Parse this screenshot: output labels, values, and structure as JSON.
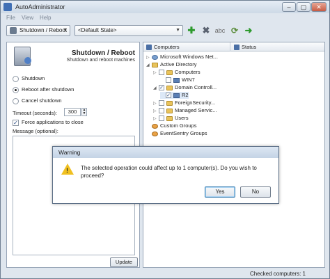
{
  "window": {
    "title": "AutoAdministrator"
  },
  "menu": [
    "File",
    "View",
    "Help"
  ],
  "toolbar": {
    "action_combo": "Shutdown / Reboot",
    "state_combo": "<Default State>",
    "icons": [
      "add-icon",
      "delete-icon",
      "rename-icon",
      "refresh-icon",
      "run-icon"
    ],
    "abc_label": "abc"
  },
  "left": {
    "title": "Shutdown / Reboot",
    "subtitle": "Shutdown and reboot machines",
    "options": [
      {
        "label": "Shutdown",
        "selected": false
      },
      {
        "label": "Reboot after shutdown",
        "selected": true
      },
      {
        "label": "Cancel shutdown",
        "selected": false
      }
    ],
    "timeout_label": "Timeout (seconds):",
    "timeout_value": "300",
    "force_label": "Force applications to close",
    "force_checked": true,
    "message_label": "Message (optional):",
    "update_label": "Update"
  },
  "right": {
    "col_computers": "Computers",
    "col_status": "Status",
    "tree": [
      {
        "label": "Microsoft Windows Net...",
        "icon": "net",
        "level": 0,
        "expander": "▷",
        "checkbox": false
      },
      {
        "label": "Active Directory",
        "icon": "folder",
        "level": 0,
        "expander": "◢",
        "checkbox": false
      },
      {
        "label": "Computers",
        "icon": "folder",
        "level": 1,
        "expander": "▷",
        "checkbox": true,
        "checked": false
      },
      {
        "label": "WIN7",
        "icon": "pc",
        "level": 2,
        "expander": "",
        "checkbox": true,
        "checked": false
      },
      {
        "label": "Domain Controll...",
        "icon": "folder",
        "level": 1,
        "expander": "◢",
        "checkbox": true,
        "checked": true
      },
      {
        "label": "R2",
        "icon": "pc",
        "level": 2,
        "expander": "",
        "checkbox": true,
        "checked": true
      },
      {
        "label": "ForeignSecurity...",
        "icon": "folder",
        "level": 1,
        "expander": "▷",
        "checkbox": true,
        "checked": false
      },
      {
        "label": "Managed Servic...",
        "icon": "folder",
        "level": 1,
        "expander": "▷",
        "checkbox": true,
        "checked": false
      },
      {
        "label": "Users",
        "icon": "folder",
        "level": 1,
        "expander": "▷",
        "checkbox": true,
        "checked": false
      },
      {
        "label": "Custom Groups",
        "icon": "group",
        "level": 0,
        "expander": "",
        "checkbox": false
      },
      {
        "label": "EventSentry Groups",
        "icon": "group",
        "level": 0,
        "expander": "",
        "checkbox": false
      }
    ]
  },
  "status": {
    "text": "Checked computers: 1"
  },
  "dialog": {
    "title": "Warning",
    "message": "The selected operation could affect up to 1 computer(s). Do you wish to proceed?",
    "yes_label": "Yes",
    "no_label": "No"
  },
  "colors": {
    "warning": "#f0c020",
    "folder": "#e9c35a",
    "add": "#2d9a2d"
  }
}
